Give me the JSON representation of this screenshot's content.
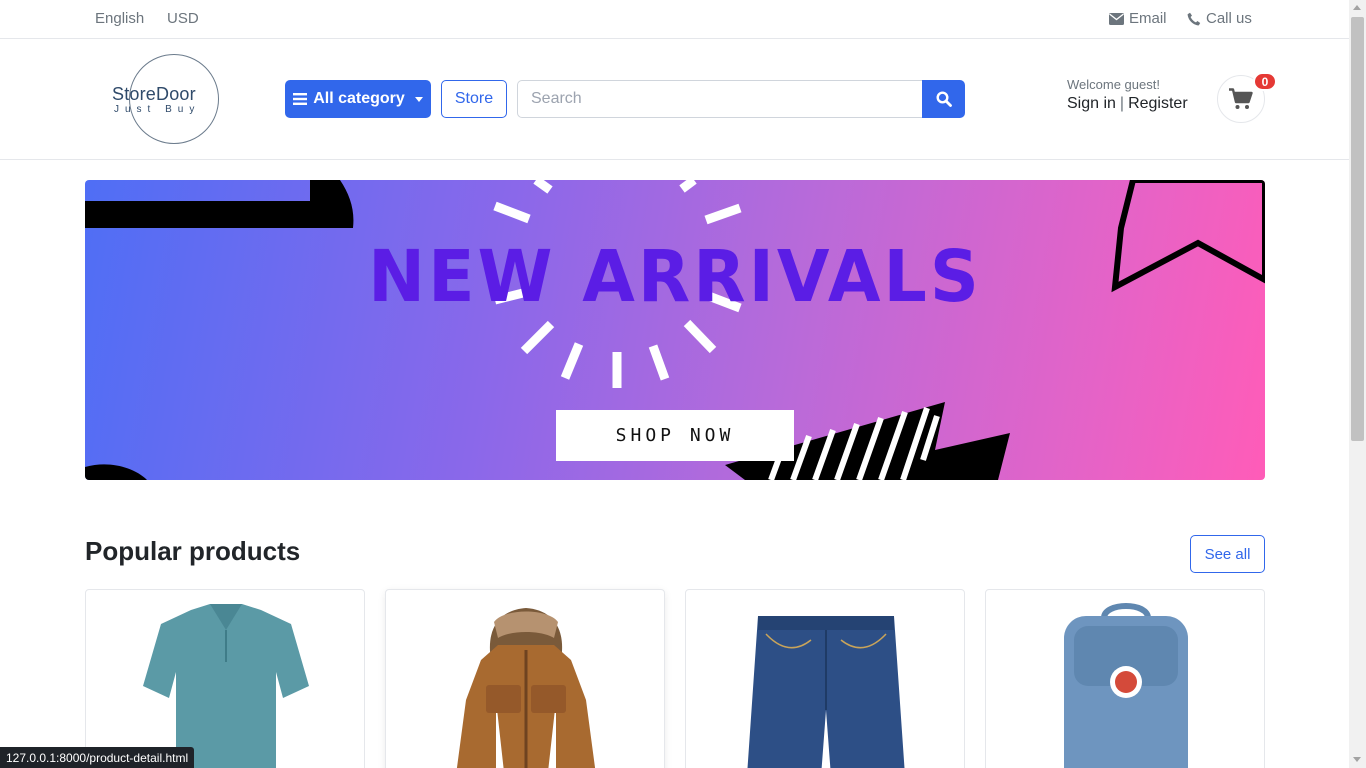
{
  "topbar": {
    "language": "English",
    "currency": "USD",
    "email_label": "Email",
    "call_label": "Call us"
  },
  "header": {
    "logo": {
      "name": "StoreDoor",
      "tagline": "Just Buy"
    },
    "category_button": "All category",
    "store_button": "Store",
    "search": {
      "placeholder": "Search"
    },
    "welcome": "Welcome guest!",
    "sign_in": "Sign in",
    "separator": "|",
    "register": "Register",
    "cart": {
      "count": "0",
      "icon": "shopping-cart-icon"
    }
  },
  "banner": {
    "headline": "NEW ARRIVALS",
    "cta": "SHOP NOW"
  },
  "popular": {
    "title": "Popular products",
    "see_all": "See all",
    "products": [
      {
        "image": "teal polo shirt"
      },
      {
        "image": "brown hooded jacket"
      },
      {
        "image": "denim shorts"
      },
      {
        "image": "blue backpack"
      }
    ]
  },
  "status_bar": {
    "url": "127.0.0.1:8000/product-detail.html"
  },
  "colors": {
    "primary": "#3167eb",
    "badge": "#e53935",
    "headline": "#5b1de5"
  }
}
